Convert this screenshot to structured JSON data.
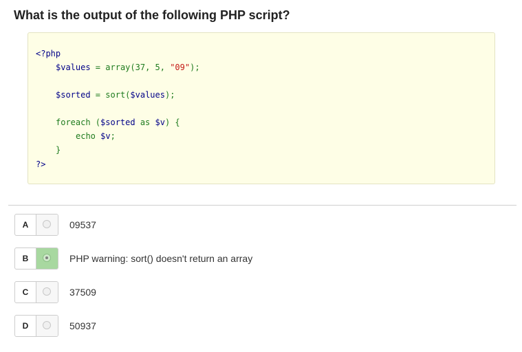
{
  "question": {
    "title": "What is the output of the following PHP script?"
  },
  "code": {
    "open_tag": "<?php",
    "line1": {
      "var": "$values",
      "op": " = ",
      "fn": "array(37, 5, ",
      "str": "\"09\"",
      "end": ");"
    },
    "line2": {
      "var": "$sorted",
      "op": " = ",
      "fn": "sort(",
      "arg": "$values",
      "end": ");"
    },
    "line3": {
      "kw": "foreach (",
      "var1": "$sorted",
      "mid": " as ",
      "var2": "$v",
      "end": ") {"
    },
    "line4": {
      "kw": "echo ",
      "var": "$v",
      "end": ";"
    },
    "close_brace": "}",
    "close_tag": "?>"
  },
  "options": [
    {
      "letter": "A",
      "text": "09537",
      "selected": false
    },
    {
      "letter": "B",
      "text": "PHP warning: sort() doesn't return an array",
      "selected": true
    },
    {
      "letter": "C",
      "text": "37509",
      "selected": false
    },
    {
      "letter": "D",
      "text": "50937",
      "selected": false
    }
  ],
  "colors": {
    "code_background": "#fefee6",
    "selected_radio": "#a8d8a0",
    "code_text": "#1e7b1e",
    "code_variable": "#000088",
    "code_string": "#c41a16"
  }
}
